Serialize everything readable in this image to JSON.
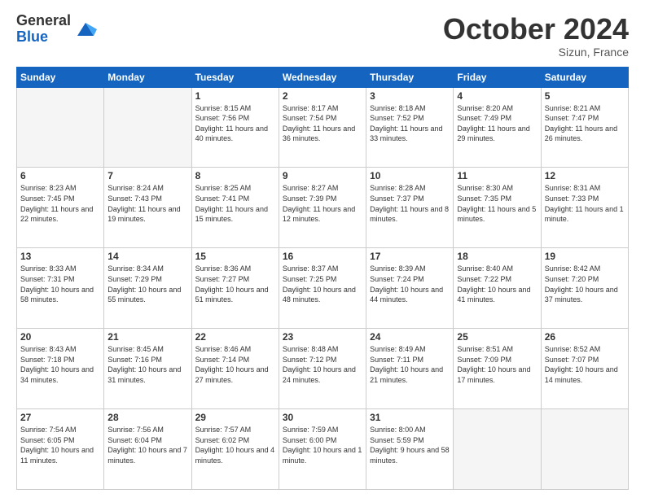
{
  "header": {
    "logo_line1": "General",
    "logo_line2": "Blue",
    "month": "October 2024",
    "location": "Sizun, France"
  },
  "weekdays": [
    "Sunday",
    "Monday",
    "Tuesday",
    "Wednesday",
    "Thursday",
    "Friday",
    "Saturday"
  ],
  "weeks": [
    [
      {
        "day": "",
        "info": ""
      },
      {
        "day": "",
        "info": ""
      },
      {
        "day": "1",
        "info": "Sunrise: 8:15 AM\nSunset: 7:56 PM\nDaylight: 11 hours and 40 minutes."
      },
      {
        "day": "2",
        "info": "Sunrise: 8:17 AM\nSunset: 7:54 PM\nDaylight: 11 hours and 36 minutes."
      },
      {
        "day": "3",
        "info": "Sunrise: 8:18 AM\nSunset: 7:52 PM\nDaylight: 11 hours and 33 minutes."
      },
      {
        "day": "4",
        "info": "Sunrise: 8:20 AM\nSunset: 7:49 PM\nDaylight: 11 hours and 29 minutes."
      },
      {
        "day": "5",
        "info": "Sunrise: 8:21 AM\nSunset: 7:47 PM\nDaylight: 11 hours and 26 minutes."
      }
    ],
    [
      {
        "day": "6",
        "info": "Sunrise: 8:23 AM\nSunset: 7:45 PM\nDaylight: 11 hours and 22 minutes."
      },
      {
        "day": "7",
        "info": "Sunrise: 8:24 AM\nSunset: 7:43 PM\nDaylight: 11 hours and 19 minutes."
      },
      {
        "day": "8",
        "info": "Sunrise: 8:25 AM\nSunset: 7:41 PM\nDaylight: 11 hours and 15 minutes."
      },
      {
        "day": "9",
        "info": "Sunrise: 8:27 AM\nSunset: 7:39 PM\nDaylight: 11 hours and 12 minutes."
      },
      {
        "day": "10",
        "info": "Sunrise: 8:28 AM\nSunset: 7:37 PM\nDaylight: 11 hours and 8 minutes."
      },
      {
        "day": "11",
        "info": "Sunrise: 8:30 AM\nSunset: 7:35 PM\nDaylight: 11 hours and 5 minutes."
      },
      {
        "day": "12",
        "info": "Sunrise: 8:31 AM\nSunset: 7:33 PM\nDaylight: 11 hours and 1 minute."
      }
    ],
    [
      {
        "day": "13",
        "info": "Sunrise: 8:33 AM\nSunset: 7:31 PM\nDaylight: 10 hours and 58 minutes."
      },
      {
        "day": "14",
        "info": "Sunrise: 8:34 AM\nSunset: 7:29 PM\nDaylight: 10 hours and 55 minutes."
      },
      {
        "day": "15",
        "info": "Sunrise: 8:36 AM\nSunset: 7:27 PM\nDaylight: 10 hours and 51 minutes."
      },
      {
        "day": "16",
        "info": "Sunrise: 8:37 AM\nSunset: 7:25 PM\nDaylight: 10 hours and 48 minutes."
      },
      {
        "day": "17",
        "info": "Sunrise: 8:39 AM\nSunset: 7:24 PM\nDaylight: 10 hours and 44 minutes."
      },
      {
        "day": "18",
        "info": "Sunrise: 8:40 AM\nSunset: 7:22 PM\nDaylight: 10 hours and 41 minutes."
      },
      {
        "day": "19",
        "info": "Sunrise: 8:42 AM\nSunset: 7:20 PM\nDaylight: 10 hours and 37 minutes."
      }
    ],
    [
      {
        "day": "20",
        "info": "Sunrise: 8:43 AM\nSunset: 7:18 PM\nDaylight: 10 hours and 34 minutes."
      },
      {
        "day": "21",
        "info": "Sunrise: 8:45 AM\nSunset: 7:16 PM\nDaylight: 10 hours and 31 minutes."
      },
      {
        "day": "22",
        "info": "Sunrise: 8:46 AM\nSunset: 7:14 PM\nDaylight: 10 hours and 27 minutes."
      },
      {
        "day": "23",
        "info": "Sunrise: 8:48 AM\nSunset: 7:12 PM\nDaylight: 10 hours and 24 minutes."
      },
      {
        "day": "24",
        "info": "Sunrise: 8:49 AM\nSunset: 7:11 PM\nDaylight: 10 hours and 21 minutes."
      },
      {
        "day": "25",
        "info": "Sunrise: 8:51 AM\nSunset: 7:09 PM\nDaylight: 10 hours and 17 minutes."
      },
      {
        "day": "26",
        "info": "Sunrise: 8:52 AM\nSunset: 7:07 PM\nDaylight: 10 hours and 14 minutes."
      }
    ],
    [
      {
        "day": "27",
        "info": "Sunrise: 7:54 AM\nSunset: 6:05 PM\nDaylight: 10 hours and 11 minutes."
      },
      {
        "day": "28",
        "info": "Sunrise: 7:56 AM\nSunset: 6:04 PM\nDaylight: 10 hours and 7 minutes."
      },
      {
        "day": "29",
        "info": "Sunrise: 7:57 AM\nSunset: 6:02 PM\nDaylight: 10 hours and 4 minutes."
      },
      {
        "day": "30",
        "info": "Sunrise: 7:59 AM\nSunset: 6:00 PM\nDaylight: 10 hours and 1 minute."
      },
      {
        "day": "31",
        "info": "Sunrise: 8:00 AM\nSunset: 5:59 PM\nDaylight: 9 hours and 58 minutes."
      },
      {
        "day": "",
        "info": ""
      },
      {
        "day": "",
        "info": ""
      }
    ]
  ]
}
